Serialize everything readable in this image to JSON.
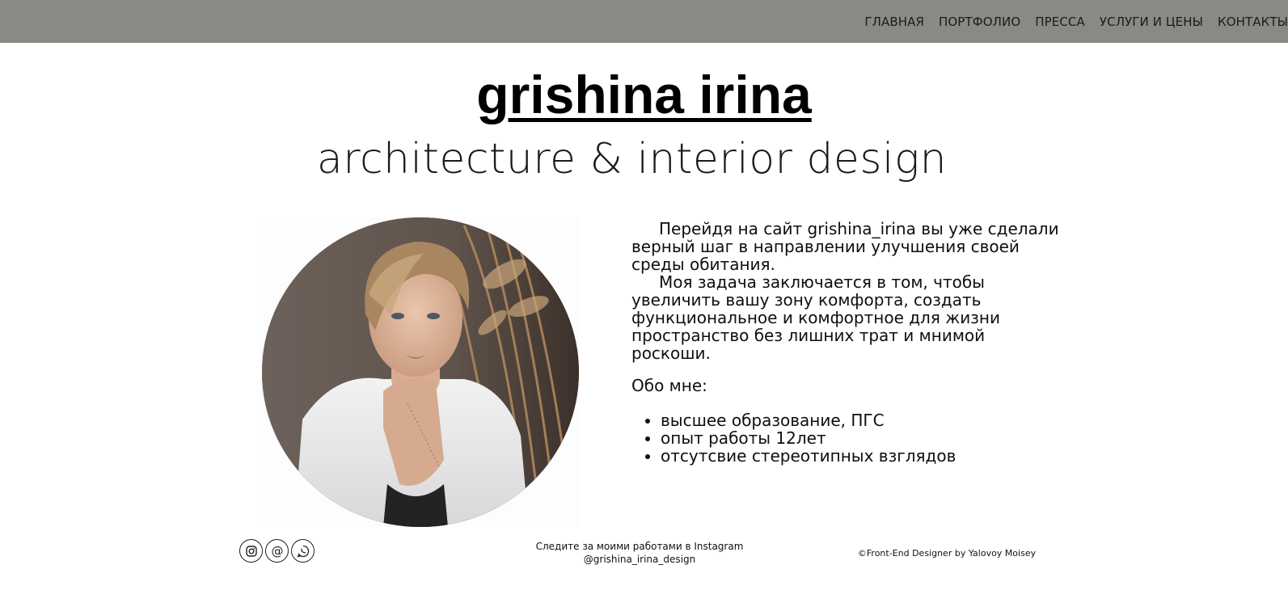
{
  "nav": {
    "items": [
      {
        "label": "ГЛАВНАЯ"
      },
      {
        "label": "ПОРТФОЛИО"
      },
      {
        "label": "ПРЕССА"
      },
      {
        "label": "УСЛУГИ И ЦЕНЫ"
      },
      {
        "label": "КОНТАКТЫ"
      }
    ]
  },
  "header": {
    "brand": "grishina irina",
    "tagline": "architecture & interior design"
  },
  "about": {
    "paragraph1": "Перейдя на сайт grishina_irina вы уже сделали верный шаг в направлении улучшения своей среды обитания.",
    "paragraph2": "Моя задача заключается в том, чтобы увеличить вашу зону комфорта, создать функциональное и комфортное для жизни пространство без лишних трат и мнимой роскоши.",
    "heading": "Обо мне:",
    "facts": [
      "высшее образование, ПГС",
      "опыт работы 12лет",
      "отсутсвие стереотипных взглядов"
    ]
  },
  "footer": {
    "follow_text": "Следите за моими работами в Instagram",
    "instagram_handle": "@grishina_irina_design",
    "copyright": "©Front-End Designer by Yalovoy Moisey",
    "social_icons": [
      "instagram-icon",
      "email-icon",
      "whatsapp-icon"
    ]
  },
  "colors": {
    "topbar": "#8a8984",
    "text": "#111111",
    "background": "#ffffff"
  }
}
